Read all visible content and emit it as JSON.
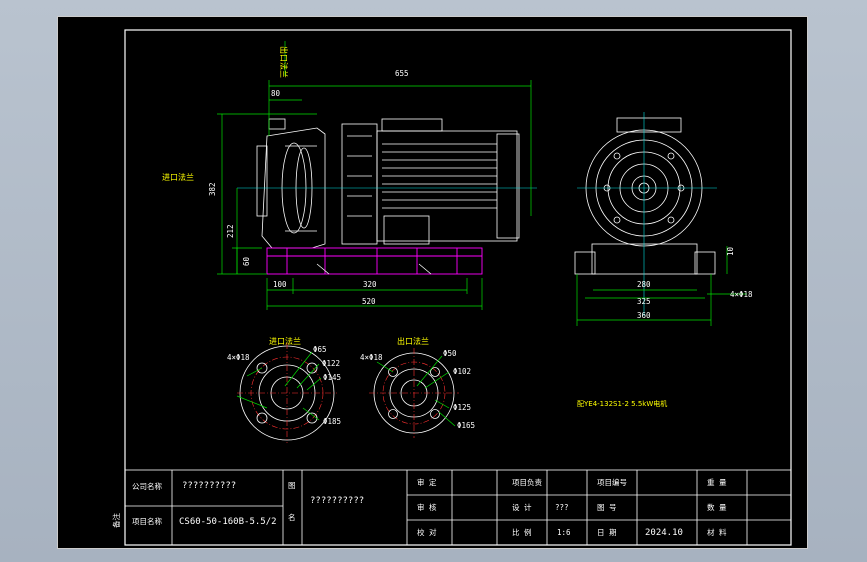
{
  "main_view": {
    "dimensions": {
      "d655": "655",
      "d80": "80",
      "d382": "382",
      "d212": "212",
      "d60": "60",
      "d100": "100",
      "d320": "320",
      "d520": "520"
    },
    "inlet_flange_label": "进口法兰",
    "outlet_flange_label": "出口法兰"
  },
  "side_view": {
    "dimensions": {
      "d280": "280",
      "d325": "325",
      "d360": "360",
      "d10": "10",
      "bolts": "4×Φ18"
    }
  },
  "inlet_flange": {
    "title": "进口法兰",
    "bolts": "4×Φ18",
    "d65": "Φ65",
    "d122": "Φ122",
    "d145": "Φ145",
    "d185": "Φ185"
  },
  "outlet_flange": {
    "title": "出口法兰",
    "bolts": "4×Φ18",
    "d50": "Φ50",
    "d102": "Φ102",
    "d125": "Φ125",
    "d165": "Φ165"
  },
  "motor_note": "配YE4-132S1-2 5.5kW电机",
  "title_block": {
    "company_label": "公司名称",
    "company_value": "??????????",
    "project_label": "项目名称",
    "project_value": "CS60-50-160B-5.5/2",
    "drawing_name_label_1": "图",
    "drawing_name_label_2": "名",
    "drawing_name_value": "??????????",
    "row1": [
      "审 定",
      "项目负责",
      "项目编号",
      "重 量"
    ],
    "row2": [
      "审 核",
      "设 计",
      "???",
      "图 号",
      "数 量"
    ],
    "row3": [
      "校 对",
      "比 例",
      "1:6",
      "日 期",
      "2024.10",
      "材 料"
    ],
    "side_label": "备注"
  }
}
